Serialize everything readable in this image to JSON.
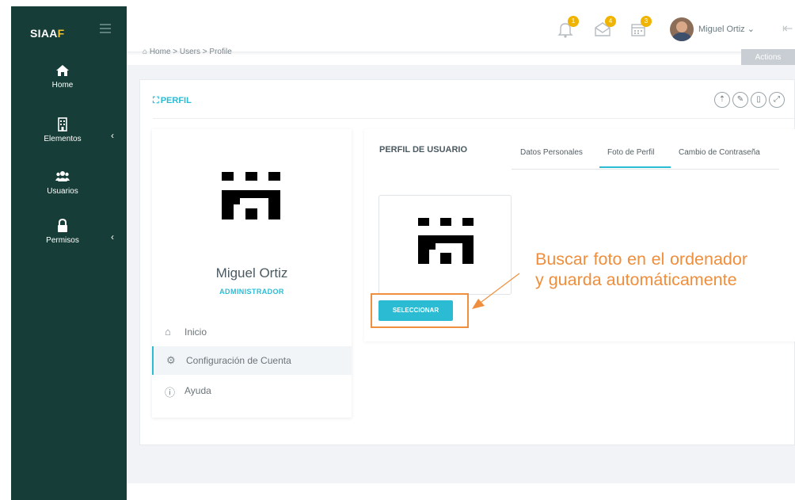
{
  "sidebar": {
    "brand": "SIAA",
    "brand_accent": "F",
    "items": [
      {
        "label": "Home",
        "icon": "home-icon"
      },
      {
        "label": "Elementos",
        "icon": "building-icon"
      },
      {
        "label": "Usuarios",
        "icon": "users-icon"
      },
      {
        "label": "Permisos",
        "icon": "lock-icon"
      }
    ]
  },
  "topbar": {
    "notifications": [
      {
        "icon": "bell-icon",
        "count": "1"
      },
      {
        "icon": "envelope-icon",
        "count": "4"
      },
      {
        "icon": "calendar-icon",
        "count": "3"
      }
    ],
    "user_name": "Miguel Ortiz"
  },
  "breadcrumb": "Home  >  Users  >  Profile",
  "actions_label": "Actions",
  "card": {
    "title": "PERFIL"
  },
  "profile": {
    "name": "Miguel Ortiz",
    "role": "ADMINISTRADOR",
    "menu": [
      {
        "label": "Inicio",
        "icon": "home-outline-icon"
      },
      {
        "label": "Configuración de Cuenta",
        "icon": "gear-icon"
      },
      {
        "label": "Ayuda",
        "icon": "info-icon"
      }
    ]
  },
  "profile_tabs": {
    "title": "PERFIL DE USUARIO",
    "tabs": [
      "Datos Personales",
      "Foto de Perfil",
      "Cambio de Contraseña"
    ],
    "active_tab": "Foto de Perfil"
  },
  "photo": {
    "select_label": "SELECCIONAR"
  },
  "annotation": {
    "text": "Buscar foto en el ordenador y guarda automáticamente",
    "color": "#ef8e3c"
  },
  "colors": {
    "sidebar": "#163d37",
    "accent": "#2bbcd4",
    "badge": "#f0b400"
  }
}
